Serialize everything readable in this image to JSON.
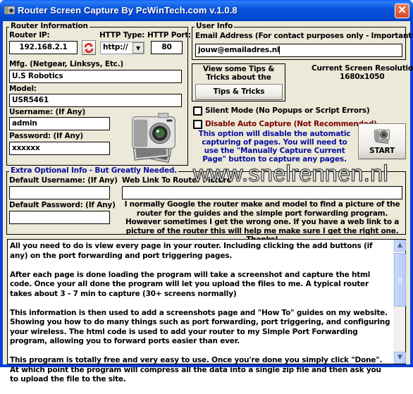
{
  "window": {
    "title": "Router Screen Capture By PcWinTech.com v.1.0.8",
    "close_label": "✕"
  },
  "router_info": {
    "group_title": "Router Information",
    "router_ip_label": "Router IP:",
    "router_ip_value": "192.168.2.1",
    "http_type_label": "HTTP Type:",
    "http_type_value": "http://",
    "http_port_label": "HTTP Port:",
    "http_port_value": "80",
    "mfg_label": "Mfg. (Netgear, Linksys, Etc.)",
    "mfg_value": "U.S Robotics",
    "model_label": "Model:",
    "model_value": "USR5461",
    "username_label": "Username: (If Any)",
    "username_value": "admin",
    "password_label": "Password: (If Any)",
    "password_value": "xxxxxx"
  },
  "user_info": {
    "group_title": "User Info",
    "email_label": "Email Address (For contact purposes only - Important!)",
    "email_value": "jouw@emailadres.nl"
  },
  "tips": {
    "text": "View some Tips & Tricks about the program.",
    "button_label": "Tips & Tricks"
  },
  "resolution": {
    "label": "Current Screen Resolution:",
    "value": "1680x1050"
  },
  "options": {
    "silent_mode_label": "Silent Mode (No Popups or Script Errors)",
    "silent_mode_checked": false,
    "disable_auto_label": "Disable Auto Capture (Not Recommended)",
    "disable_auto_checked": false,
    "disable_auto_note": "This option will disable the automatic capturing of pages. You will need to use the \"Manually Capture Current Page\" button to capture any pages."
  },
  "start_button_label": "START",
  "extra_info": {
    "group_title": "Extra Optional Info - But Greatly Needed.",
    "default_username_label": "Default Username: (If Any)",
    "default_username_value": "",
    "default_password_label": "Default Password: (If Any)",
    "default_password_value": "",
    "web_link_label": "Web Link To Router Picture",
    "web_link_value": "",
    "note": "I normally Google the router make and model to find a picture of the router for the guides and the simple port forwarding program. However sometimes I get the wrong one. If you have a web link to a picture of the router this will help me make sure I get the right one. Thanks!"
  },
  "watermark": "www.snelrennen.nl",
  "instructions": [
    "All you need to do is view every page in your router. Including clicking the add buttons (if any) on the port forwarding and port triggering pages.",
    "After each page is done loading the program will take a screenshot and capture the html code. Once your all done the program will let you upload the files to me. A typical router takes about 3 - 7 min to capture (30+ screens normally)",
    "This information is then used to add a screenshots page and \"How To\" guides on my website. Showing you how to do many things such as port forwarding, port triggering, and configuring your wireless. The html code is used to add your router to my Simple Port Forwarding program, allowing you to forward ports easier than ever.",
    "This program is totally free and very easy to use. Once you're done you simply click \"Done\". At which point the program will compress all the data into a single zip file and then ask you to upload the file to the site."
  ]
}
